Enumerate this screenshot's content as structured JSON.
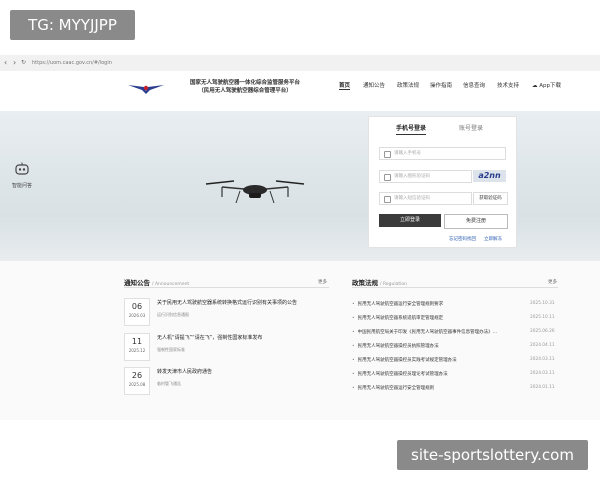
{
  "watermark_top": "TG: MYYJJPP",
  "watermark_bottom": "site-sportslottery.com",
  "browser": {
    "url": "https://uom.caac.gov.cn/#/login"
  },
  "header": {
    "title_line1": "国家无人驾驶航空器一体化综合监管服务平台",
    "title_line2": "（民用无人驾驶航空器综合管理平台）",
    "nav": [
      "首页",
      "通知公告",
      "政策法规",
      "操作指南",
      "信息查询",
      "技术支持",
      "App下载"
    ]
  },
  "ai_helper": {
    "label": "智能问答"
  },
  "login": {
    "tab_phone": "手机号登录",
    "tab_account": "账号登录",
    "phone_placeholder": "请输入手机号",
    "captcha_placeholder": "请输入图形验证码",
    "captcha_text": "a2nn",
    "sms_placeholder": "请输入短信验证码",
    "sms_button": "获取验证码",
    "login_button": "立即登录",
    "register_button": "免费注册",
    "forgot_link": "忘记密码找回",
    "unfreeze_link": "立即解冻"
  },
  "notices": {
    "title": "通知公告",
    "subtitle": "/ Announcement",
    "more": "更多",
    "items": [
      {
        "day": "06",
        "month": "2026.03",
        "title": "关于民用无人驾驶航空器系统转换格式运行识别有关事项的公告",
        "sub": "运行识别信息通报"
      },
      {
        "day": "11",
        "month": "2025.12",
        "title": "无人机“请提飞”“请在飞”，强制性国家标准发布",
        "sub": "强制性国家标准"
      },
      {
        "day": "26",
        "month": "2025.08",
        "title": "转发天津市人民政府通告",
        "sub": "临时管飞通告"
      }
    ]
  },
  "policies": {
    "title": "政策法规",
    "subtitle": "/ Regulation",
    "more": "更多",
    "items": [
      {
        "title": "民用无人驾驶航空器运行安全管理规则要求",
        "date": "2025.10.31"
      },
      {
        "title": "民用无人驾驶航空器系统适航审定管理规定",
        "date": "2025.10.11"
      },
      {
        "title": "中国民用航空局关于印发《民用无人驾驶航空器事件信息管理办法》…",
        "date": "2025.06.26"
      },
      {
        "title": "民用无人驾驶航空器操控员执照管理办法",
        "date": "2024.04.11"
      },
      {
        "title": "民用无人驾驶航空器操控员实践考试规定管理办法",
        "date": "2024.03.11"
      },
      {
        "title": "民用无人驾驶航空器操控员理论考试管理办法",
        "date": "2024.03.11"
      },
      {
        "title": "民用无人驾驶航空器运行安全管理规则",
        "date": "2024.01.11"
      }
    ]
  }
}
